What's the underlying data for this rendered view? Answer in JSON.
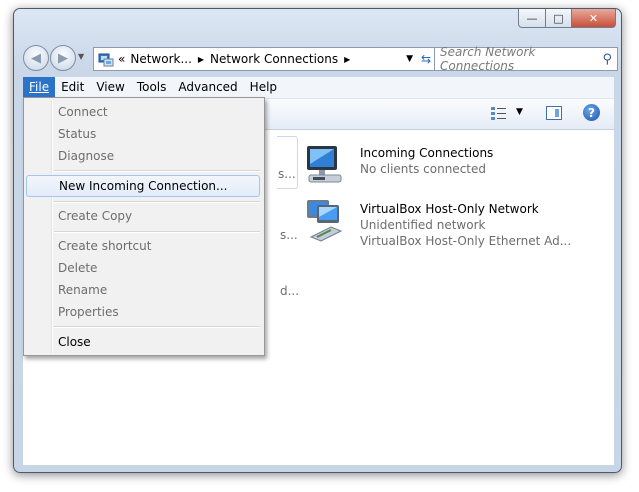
{
  "window": {
    "buttons": {
      "minimize": "—",
      "maximize": "□",
      "close": "✕"
    }
  },
  "nav": {
    "back_icon": "back-arrow",
    "forward_icon": "forward-arrow",
    "breadcrumb_prefix": "«",
    "breadcrumb": [
      "Network...",
      "Network Connections"
    ],
    "refresh_icon": "refresh-arrows",
    "search_placeholder": "Search Network Connections"
  },
  "menubar": {
    "items": [
      "File",
      "Edit",
      "View",
      "Tools",
      "Advanced",
      "Help"
    ]
  },
  "file_menu": {
    "items": [
      {
        "label": "Connect",
        "enabled": false
      },
      {
        "label": "Status",
        "enabled": false
      },
      {
        "label": "Diagnose",
        "enabled": false
      },
      {
        "label": "New Incoming Connection...",
        "enabled": true
      },
      {
        "label": "Create Copy",
        "enabled": false
      },
      {
        "label": "Create shortcut",
        "enabled": false
      },
      {
        "label": "Delete",
        "enabled": false
      },
      {
        "label": "Rename",
        "enabled": false
      },
      {
        "label": "Properties",
        "enabled": false
      },
      {
        "label": "Close",
        "enabled": true
      }
    ]
  },
  "connections": [
    {
      "name": "Incoming Connections",
      "status": "No clients connected",
      "device": ""
    },
    {
      "name": "VirtualBox Host-Only Network",
      "status": "Unidentified network",
      "device": "VirtualBox Host-Only Ethernet Ad..."
    }
  ],
  "partial_text": {
    "row1": "s...",
    "row2": "s...",
    "row3": "d..."
  },
  "colors": {
    "menu_highlight": "#2b73c9",
    "window_frame": "#c9d7e8"
  }
}
